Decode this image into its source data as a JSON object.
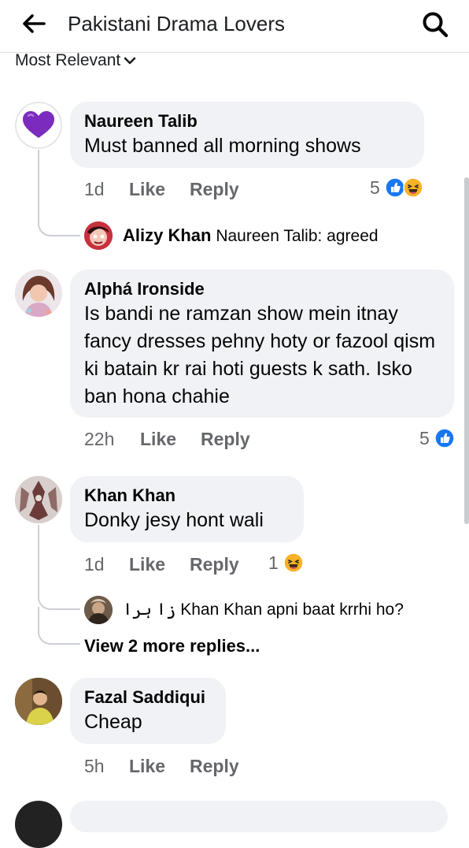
{
  "header": {
    "title": "Pakistani Drama Lovers",
    "back_icon": "arrow-left-icon",
    "search_icon": "search-icon"
  },
  "sort": {
    "label": "Most Relevant"
  },
  "comments": [
    {
      "name": "Naureen Talib",
      "text": "Must banned all morning shows",
      "time": "1d",
      "like": "Like",
      "reply": "Reply",
      "reactions": "5",
      "reaction_icons": [
        "like",
        "haha"
      ],
      "reply_preview": {
        "name": "Alizy Khan",
        "text": "Naureen Talib: agreed"
      }
    },
    {
      "name": "Alphá Ironside",
      "text": "Is bandi ne ramzan show mein itnay fancy dresses pehny hoty or fazool qism ki batain kr rai hoti guests k sath. Isko ban hona chahie",
      "time": "22h",
      "like": "Like",
      "reply": "Reply",
      "reactions": "5",
      "reaction_icons": [
        "like"
      ]
    },
    {
      "name": "Khan Khan",
      "text": "Donky jesy hont wali",
      "time": "1d",
      "like": "Like",
      "reply": "Reply",
      "reactions": "1",
      "reaction_icons": [
        "haha"
      ],
      "reply_preview": {
        "name": "زا ہرا",
        "text": "Khan Khan apni baat krrhi ho?"
      },
      "more_replies": "View 2 more replies..."
    },
    {
      "name": "Fazal Saddiqui",
      "text": "Cheap",
      "time": "5h",
      "like": "Like",
      "reply": "Reply"
    }
  ],
  "colors": {
    "like_blue": "#1877f2",
    "haha_yellow": "#f7b125",
    "bubble": "#f0f2f5",
    "meta_gray": "#65676b"
  }
}
